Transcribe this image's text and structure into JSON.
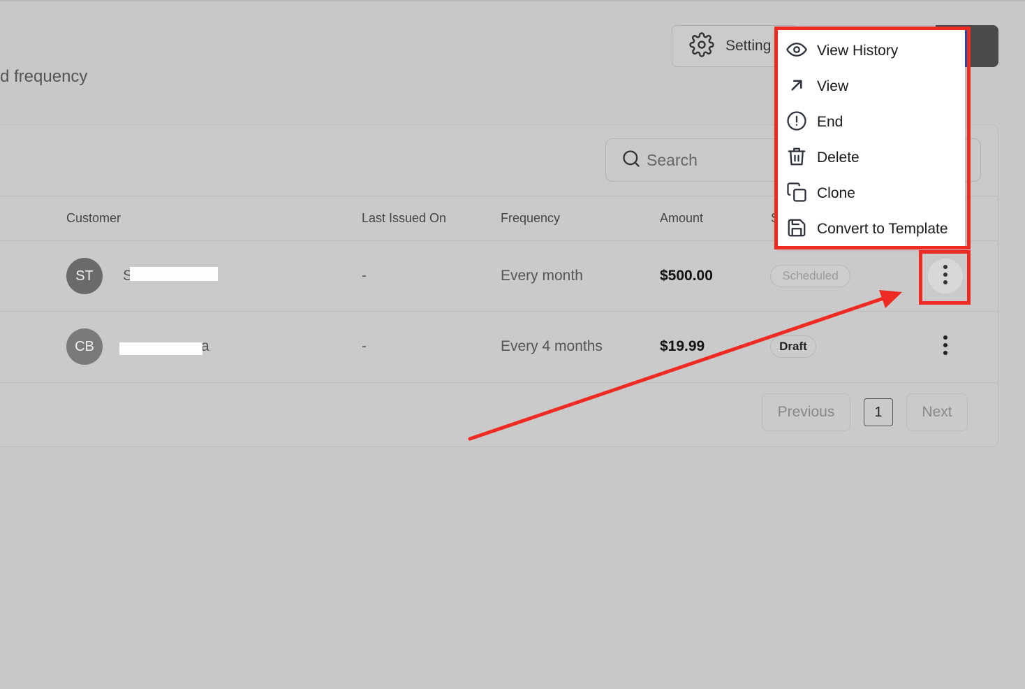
{
  "page": {
    "subtitle": "d frequency"
  },
  "header": {
    "settings_label": "Setting"
  },
  "search": {
    "placeholder": "Search"
  },
  "table": {
    "columns": [
      "Customer",
      "Last Issued On",
      "Frequency",
      "Amount",
      "S"
    ],
    "rows": [
      {
        "initials": "ST",
        "name_visible": "S",
        "last_issued": "-",
        "frequency": "Every month",
        "amount": "$500.00",
        "status": "Scheduled"
      },
      {
        "initials": "CB",
        "name_visible": "a",
        "last_issued": "-",
        "frequency": "Every 4 months",
        "amount": "$19.99",
        "status": "Draft"
      }
    ]
  },
  "pagination": {
    "previous": "Previous",
    "page": "1",
    "next": "Next"
  },
  "menu": {
    "items": [
      {
        "label": "View History",
        "icon": "eye-icon"
      },
      {
        "label": "View",
        "icon": "arrow-up-right-icon"
      },
      {
        "label": "End",
        "icon": "alert-circle-icon"
      },
      {
        "label": "Delete",
        "icon": "trash-icon"
      },
      {
        "label": "Clone",
        "icon": "copy-icon"
      },
      {
        "label": "Convert to Template",
        "icon": "save-icon"
      }
    ]
  },
  "colors": {
    "annotation": "#ee2a22",
    "primary_edge": "#2852b4"
  }
}
